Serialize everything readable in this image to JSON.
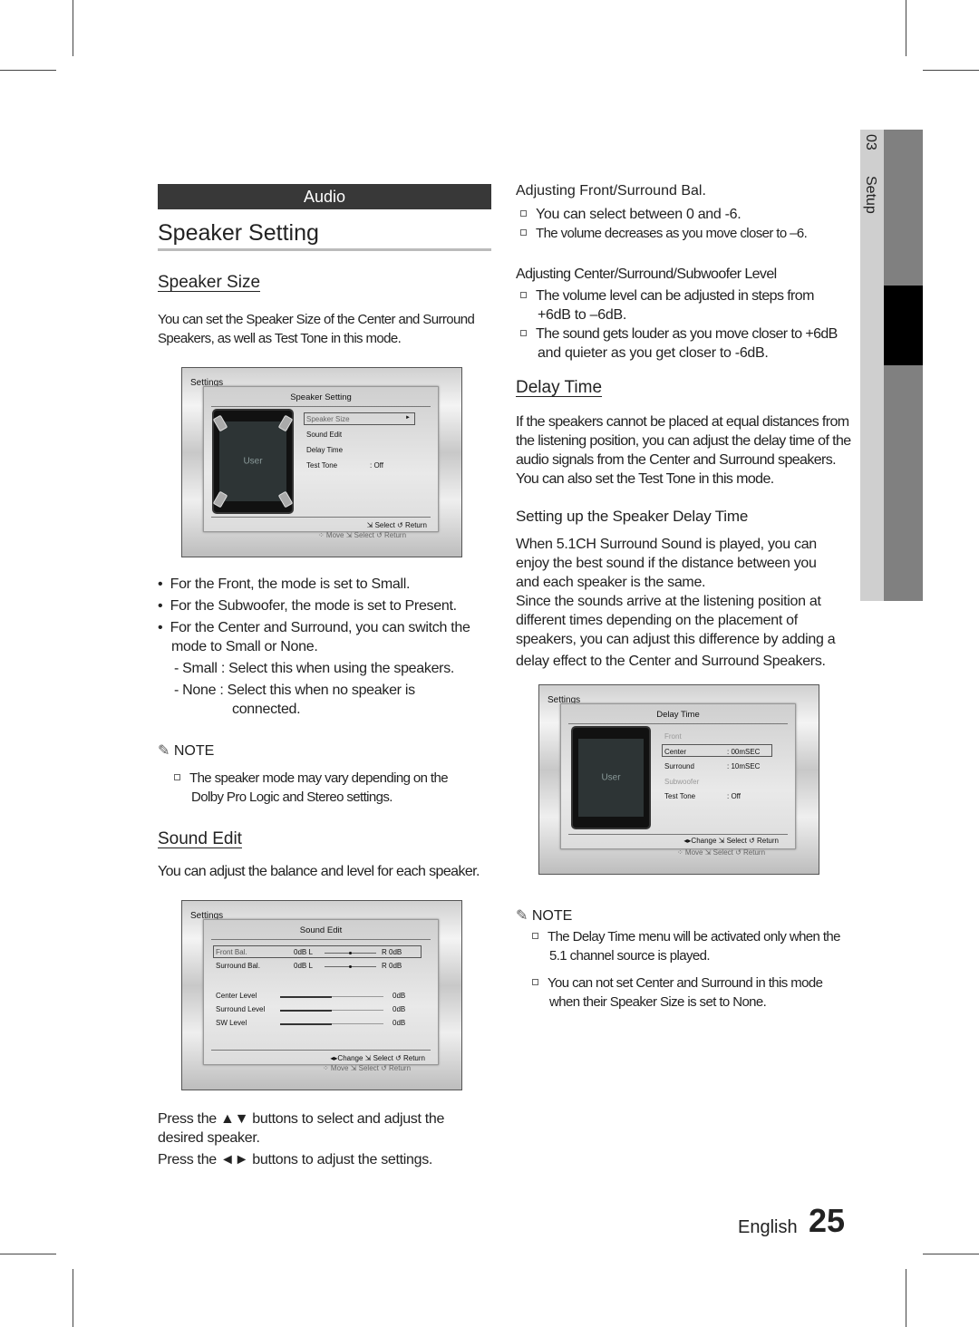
{
  "section_label": "Audio",
  "page_title": "Speaker Setting",
  "side_tab": {
    "number": "03",
    "label": "Setup"
  },
  "footer": {
    "language": "English",
    "page_number": "25"
  },
  "left": {
    "speaker_size": {
      "heading": "Speaker Size",
      "intro": [
        "You can set the Speaker Size of the Center and Surround",
        "Speakers, as well as Test Tone in this mode."
      ],
      "bullets": [
        "For the Front, the mode is set to Small.",
        "For the Subwoofer, the mode is set to Present.",
        "For the Center and Surround, you can switch the",
        "mode to Small or None."
      ],
      "sub": [
        {
          "term": "- Small",
          "text": ":  Select this when using the speakers."
        },
        {
          "term": "- None",
          "text": ": Select this when no speaker is",
          "cont": "connected."
        }
      ],
      "note_label": "NOTE",
      "note": [
        "The speaker mode may vary depending on the",
        "Dolby Pro Logic and Stereo settings."
      ]
    },
    "sound_edit": {
      "heading": "Sound Edit",
      "intro": "You can adjust the balance and level for each speaker.",
      "press": [
        "Press the ▲▼ buttons to select and adjust the",
        "desired speaker.",
        "Press the ◄► buttons to adjust the settings."
      ]
    }
  },
  "right": {
    "front_bal": {
      "heading": "Adjusting Front/Surround Bal.",
      "items": [
        "You can select between 0 and -6.",
        "The volume decreases as you move closer to –6."
      ]
    },
    "level": {
      "heading": "Adjusting Center/Surround/Subwoofer Level",
      "items": [
        [
          "The volume level can be adjusted in steps from",
          "+6dB to –6dB."
        ],
        [
          "The sound gets louder as you move closer to +6dB",
          "and quieter as you get closer to -6dB."
        ]
      ]
    },
    "delay": {
      "heading": "Delay Time",
      "intro": [
        "If the speakers cannot be placed at equal distances from",
        "the listening position, you can adjust the delay time of the",
        "audio signals from the Center and  Surround speakers.",
        "You can also set the Test Tone in this mode."
      ]
    },
    "setup_delay": {
      "heading": "Setting up the Speaker Delay Time",
      "text": [
        "When 5.1CH Surround Sound is played, you can",
        "enjoy the best sound if the distance between you",
        "and each speaker is the same.",
        "Since the sounds arrive at the listening position at",
        "different times depending on the placement of",
        "speakers, you can adjust this difference by adding a",
        "delay effect to the Center and Surround Speakers."
      ]
    },
    "note_label": "NOTE",
    "notes": [
      [
        "The Delay Time menu will be activated only when the",
        "5.1 channel source is played."
      ],
      [
        "You can not set Center and Surround in this mode",
        "when their Speaker Size is set to None."
      ]
    ]
  },
  "screens": {
    "speaker_setting": {
      "bg": "Settings",
      "title": "Speaker Setting",
      "user": "User",
      "items": [
        "Speaker Size",
        "Sound Edit",
        "Delay Time",
        "Test Tone"
      ],
      "test_tone": ":   Off",
      "arrow": "►",
      "footer": "⇲ Select   ↺ Return",
      "back_footer": "⁘ Move    ⇲ Select    ↺ Return"
    },
    "sound_edit": {
      "bg": "Settings",
      "title": "Sound Edit",
      "rows": [
        {
          "label": "Front Bal.",
          "left": "0dB L",
          "right": "R  0dB",
          "balance": 0
        },
        {
          "label": "Surround Bal.",
          "left": "0dB L",
          "right": "R  0dB",
          "balance": 0
        }
      ],
      "levels": [
        {
          "label": "Center Level",
          "value": "0dB",
          "level": 0.5
        },
        {
          "label": "Surround Level",
          "value": "0dB",
          "level": 0.5
        },
        {
          "label": "SW Level",
          "value": "0dB",
          "level": 0.5
        }
      ],
      "footer": "◂▸Change ⇲ Select   ↺ Return",
      "back_footer": "⁘ Move    ⇲ Select    ↺ Return"
    },
    "delay_time": {
      "bg": "Settings",
      "title": "Delay Time",
      "user": "User",
      "items": [
        {
          "label": "Front",
          "value": ""
        },
        {
          "label": "Center",
          "value": ":   00mSEC"
        },
        {
          "label": "Surround",
          "value": ":   10mSEC"
        },
        {
          "label": "Subwoofer",
          "value": ""
        },
        {
          "label": "Test Tone",
          "value": ":   Off"
        }
      ],
      "footer": "◂▸Change ⇲ Select   ↺ Return",
      "back_footer": "⁘ Move    ⇲ Select    ↺ Return"
    }
  }
}
